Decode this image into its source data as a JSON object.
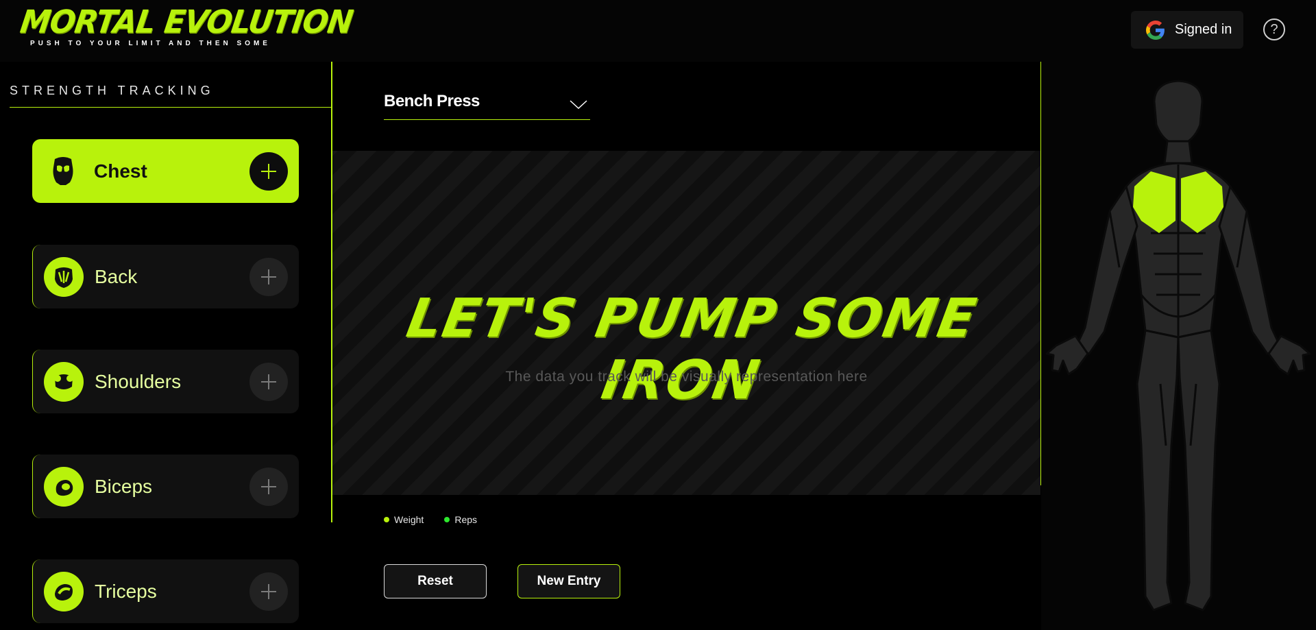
{
  "header": {
    "logo_title": "MORTAL EVOLUTION",
    "logo_subtitle": "PUSH TO YOUR LIMIT AND THEN SOME",
    "signin_label": "Signed in",
    "help_label": "?"
  },
  "sidebar": {
    "section_title": "STRENGTH TRACKING",
    "muscles": [
      {
        "label": "Chest",
        "active": true
      },
      {
        "label": "Back",
        "active": false
      },
      {
        "label": "Shoulders",
        "active": false
      },
      {
        "label": "Biceps",
        "active": false
      },
      {
        "label": "Triceps",
        "active": false
      }
    ]
  },
  "main": {
    "exercise_select": {
      "value": "Bench Press"
    },
    "headline": "LET'S PUMP SOME IRON",
    "subtext": "The data you track will be visually representation here",
    "legend": [
      {
        "label": "Weight",
        "color": "#b8f20c"
      },
      {
        "label": "Reps",
        "color": "#2ee82e"
      }
    ],
    "reset_label": "Reset",
    "new_entry_label": "New Entry"
  },
  "body_map": {
    "highlighted_muscle": "chest"
  },
  "colors": {
    "accent": "#b8f20c",
    "background": "#000000",
    "card": "#111111",
    "body_fill": "#262626"
  }
}
